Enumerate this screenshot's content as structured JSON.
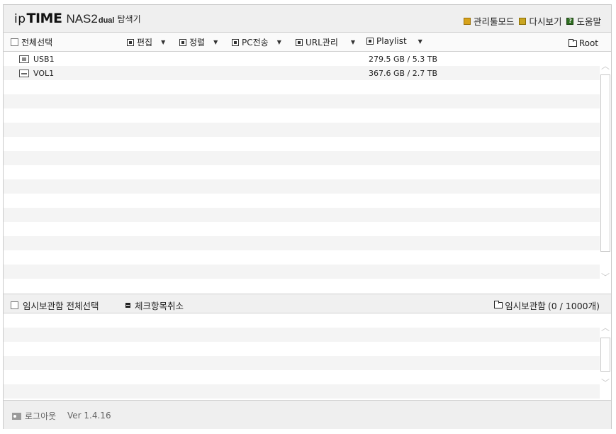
{
  "header": {
    "logo_ip": "ip",
    "logo_time": "TIME",
    "logo_nas": "NAS2",
    "logo_dual": "dual",
    "logo_explorer": "탐색기",
    "links": {
      "admin_mode": "관리툴모드",
      "reload": "다시보기",
      "help": "도움말"
    }
  },
  "toolbar": {
    "select_all": "전체선택",
    "edit": "편집",
    "sort": "정렬",
    "pc_transfer": "PC전송",
    "url_manage": "URL관리",
    "playlist": "Playlist",
    "root": "Root"
  },
  "files": [
    {
      "name": "USB1",
      "size": "279.5 GB / 5.3 TB",
      "icon": "usb-drive-icon"
    },
    {
      "name": "VOL1",
      "size": "367.6 GB / 2.7 TB",
      "icon": "volume-drive-icon"
    }
  ],
  "temp": {
    "select_all": "임시보관함 전체선택",
    "uncheck": "체크항목취소",
    "label": "임시보관함",
    "count": "(0 / 1000개)"
  },
  "footer": {
    "logout": "로그아웃",
    "version": "Ver 1.4.16"
  },
  "colors": {
    "admin_icon": "#d7a21a",
    "help_icon": "#2d6c1f"
  }
}
